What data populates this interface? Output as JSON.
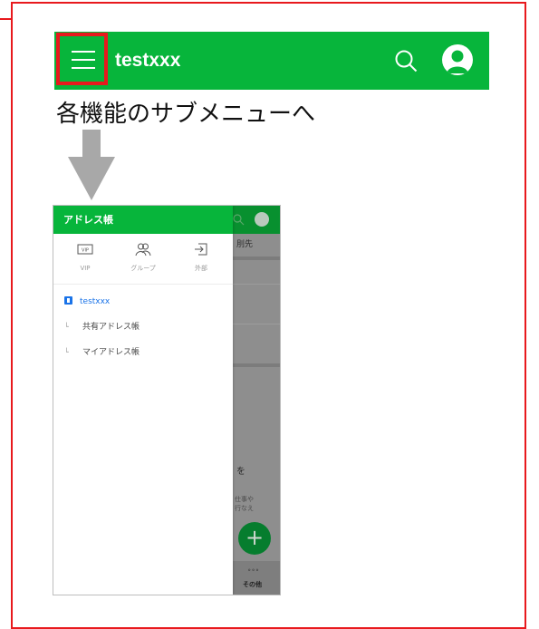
{
  "header": {
    "title": "testxxx",
    "menu_icon": "hamburger-menu-icon",
    "search_icon": "search-icon",
    "profile_icon": "avatar-icon",
    "colors": {
      "bar": "#07b53b",
      "highlight": "#e8191d"
    }
  },
  "caption": "各機能のサブメニューへ",
  "drawer": {
    "title": "アドレス帳",
    "categories": [
      {
        "label": "VIP",
        "icon": "vip-icon",
        "icon_text": "VIP"
      },
      {
        "label": "グループ",
        "icon": "group-icon"
      },
      {
        "label": "外部",
        "icon": "external-icon"
      }
    ],
    "tree": [
      {
        "label": "testxxx",
        "icon": "address-book-icon"
      },
      {
        "label": "共有アドレス帳",
        "glyph": "└"
      },
      {
        "label": "マイアドレス帳",
        "glyph": "└"
      }
    ]
  },
  "background_screen": {
    "fragments": [
      "刖先",
      "を",
      "仕事や",
      "行なえ"
    ],
    "fab_label": "+",
    "more_dots": "∘∘∘",
    "more_label": "その他"
  }
}
